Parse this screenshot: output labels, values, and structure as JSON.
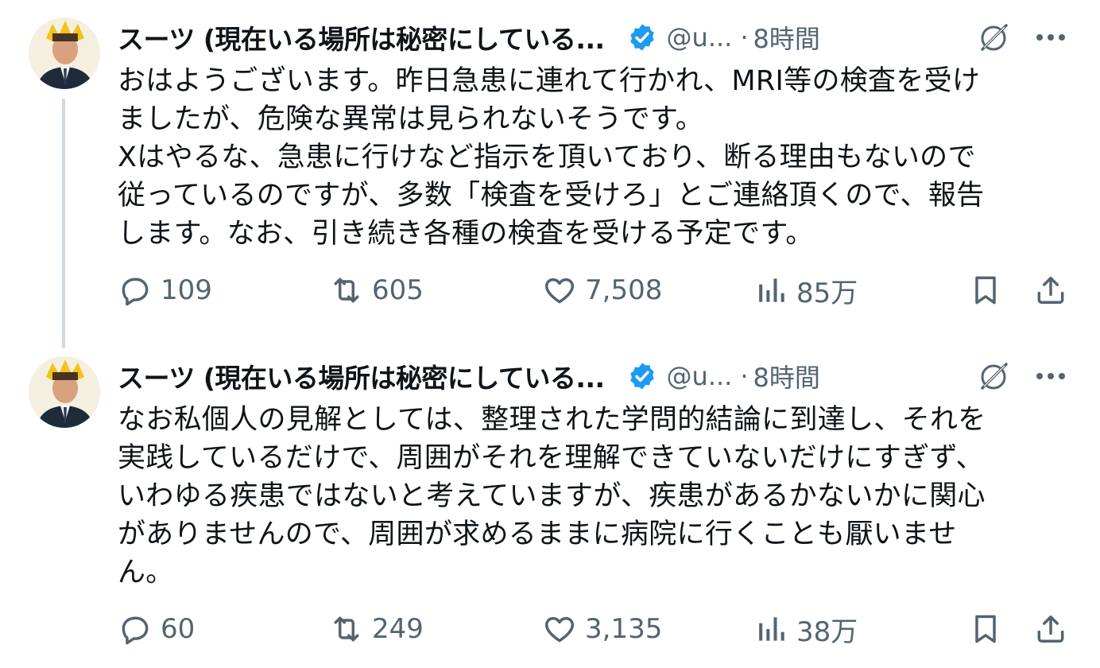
{
  "tweets": [
    {
      "author_name": "スーツ (現在いる場所は秘密にしている...",
      "handle": "@u...",
      "separator": "·",
      "time": "8時間",
      "text": "おはようございます。昨日急患に連れて行かれ、MRI等の検査を受け\nましたが、危険な異常は見られないそうです。\nXはやるな、急患に行けなど指示を頂いており、断る理由もないので\n従っているのですが、多数「検査を受けろ」とご連絡頂くので、報告\nします。なお、引き続き各種の検査を受ける予定です。",
      "replies": "109",
      "reposts": "605",
      "likes": "7,508",
      "views": "85万"
    },
    {
      "author_name": "スーツ (現在いる場所は秘密にしている...",
      "handle": "@u...",
      "separator": "·",
      "time": "8時間",
      "text": "なお私個人の見解としては、整理された学問的結論に到達し、それを\n実践しているだけで、周囲がそれを理解できていないだけにすぎず、\nいわゆる疾患ではないと考えていますが、疾患があるかないかに関心\nがありませんので、周囲が求めるままに病院に行くことも厭いませ\nん。",
      "replies": "60",
      "reposts": "249",
      "likes": "3,135",
      "views": "38万"
    }
  ],
  "icons": {
    "verified": "verified-badge-icon",
    "grok": "grok-icon",
    "more": "more-dots-icon",
    "reply": "reply-bubble-icon",
    "repost": "repost-arrows-icon",
    "like": "heart-icon",
    "views": "views-bars-icon",
    "bookmark": "bookmark-icon",
    "share": "share-icon"
  },
  "colors": {
    "text": "#0f1419",
    "secondary": "#536471",
    "verified": "#1d9bf0",
    "thread_line": "#cfd9de",
    "background": "#ffffff"
  }
}
